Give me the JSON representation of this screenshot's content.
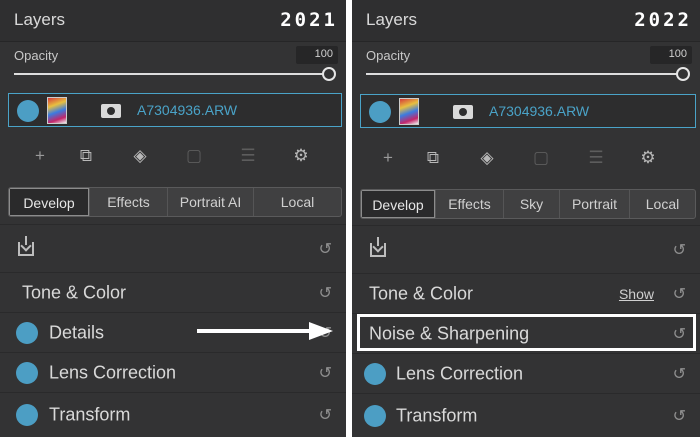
{
  "left": {
    "title": "Layers",
    "year": "2021",
    "opacity_label": "Opacity",
    "opacity_value": "100",
    "opacity_level": 1.0,
    "layer_name": "A7304936.ARW",
    "tabs": [
      "Develop",
      "Effects",
      "Portrait AI",
      "Local"
    ],
    "active_tab": "Develop",
    "sections": {
      "tone_color": "Tone & Color",
      "details": "Details",
      "lens": "Lens Correction",
      "transform": "Transform"
    }
  },
  "right": {
    "title": "Layers",
    "year": "2022",
    "opacity_label": "Opacity",
    "opacity_value": "100",
    "opacity_level": 1.0,
    "layer_name": "A7304936.ARW",
    "tabs": [
      "Develop",
      "Effects",
      "Sky",
      "Portrait",
      "Local"
    ],
    "active_tab": "Develop",
    "sections": {
      "tone_color": "Tone & Color",
      "show_link": "Show",
      "noise": "Noise & Sharpening",
      "lens": "Lens Correction",
      "transform": "Transform"
    }
  },
  "icons": {
    "add": "+",
    "copy": "⧉",
    "fill": "◈",
    "doc": "▢",
    "stack": "☰",
    "settings": "⚙",
    "reset": "↺"
  },
  "colors": {
    "accent": "#4aa3c8",
    "panel": "#333334",
    "highlight": "#ffffff"
  }
}
